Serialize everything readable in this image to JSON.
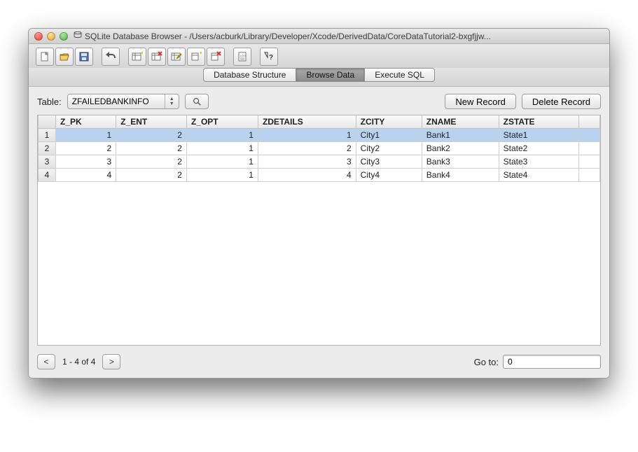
{
  "window": {
    "title": "SQLite Database Browser - /Users/acburk/Library/Developer/Xcode/DerivedData/CoreDataTutorial2-bxgfjjw..."
  },
  "tabs": {
    "items": [
      "Database Structure",
      "Browse Data",
      "Execute SQL"
    ],
    "active": 1
  },
  "table_controls": {
    "label": "Table:",
    "selected": "ZFAILEDBANKINFO",
    "new_record": "New Record",
    "delete_record": "Delete Record"
  },
  "grid": {
    "columns": [
      "Z_PK",
      "Z_ENT",
      "Z_OPT",
      "ZDETAILS",
      "ZCITY",
      "ZNAME",
      "ZSTATE"
    ],
    "numeric_cols": [
      0,
      1,
      2,
      3
    ],
    "selected_row": 0,
    "rows": [
      {
        "n": "1",
        "cells": [
          "1",
          "2",
          "1",
          "1",
          "City1",
          "Bank1",
          "State1"
        ]
      },
      {
        "n": "2",
        "cells": [
          "2",
          "2",
          "1",
          "2",
          "City2",
          "Bank2",
          "State2"
        ]
      },
      {
        "n": "3",
        "cells": [
          "3",
          "2",
          "1",
          "3",
          "City3",
          "Bank3",
          "State3"
        ]
      },
      {
        "n": "4",
        "cells": [
          "4",
          "2",
          "1",
          "4",
          "City4",
          "Bank4",
          "State4"
        ]
      }
    ]
  },
  "footer": {
    "prev": "<",
    "next": ">",
    "info": "1 - 4 of 4",
    "goto_label": "Go to:",
    "goto_value": "0"
  },
  "icons": {
    "new_db": "new-database",
    "open_db": "open-database",
    "save_db": "save-database",
    "undo": "undo",
    "create_table": "create-table",
    "delete_table": "delete-table",
    "modify_table": "modify-table",
    "create_index": "create-index",
    "delete_index": "delete-index",
    "log": "log",
    "whatsthis": "whats-this"
  }
}
